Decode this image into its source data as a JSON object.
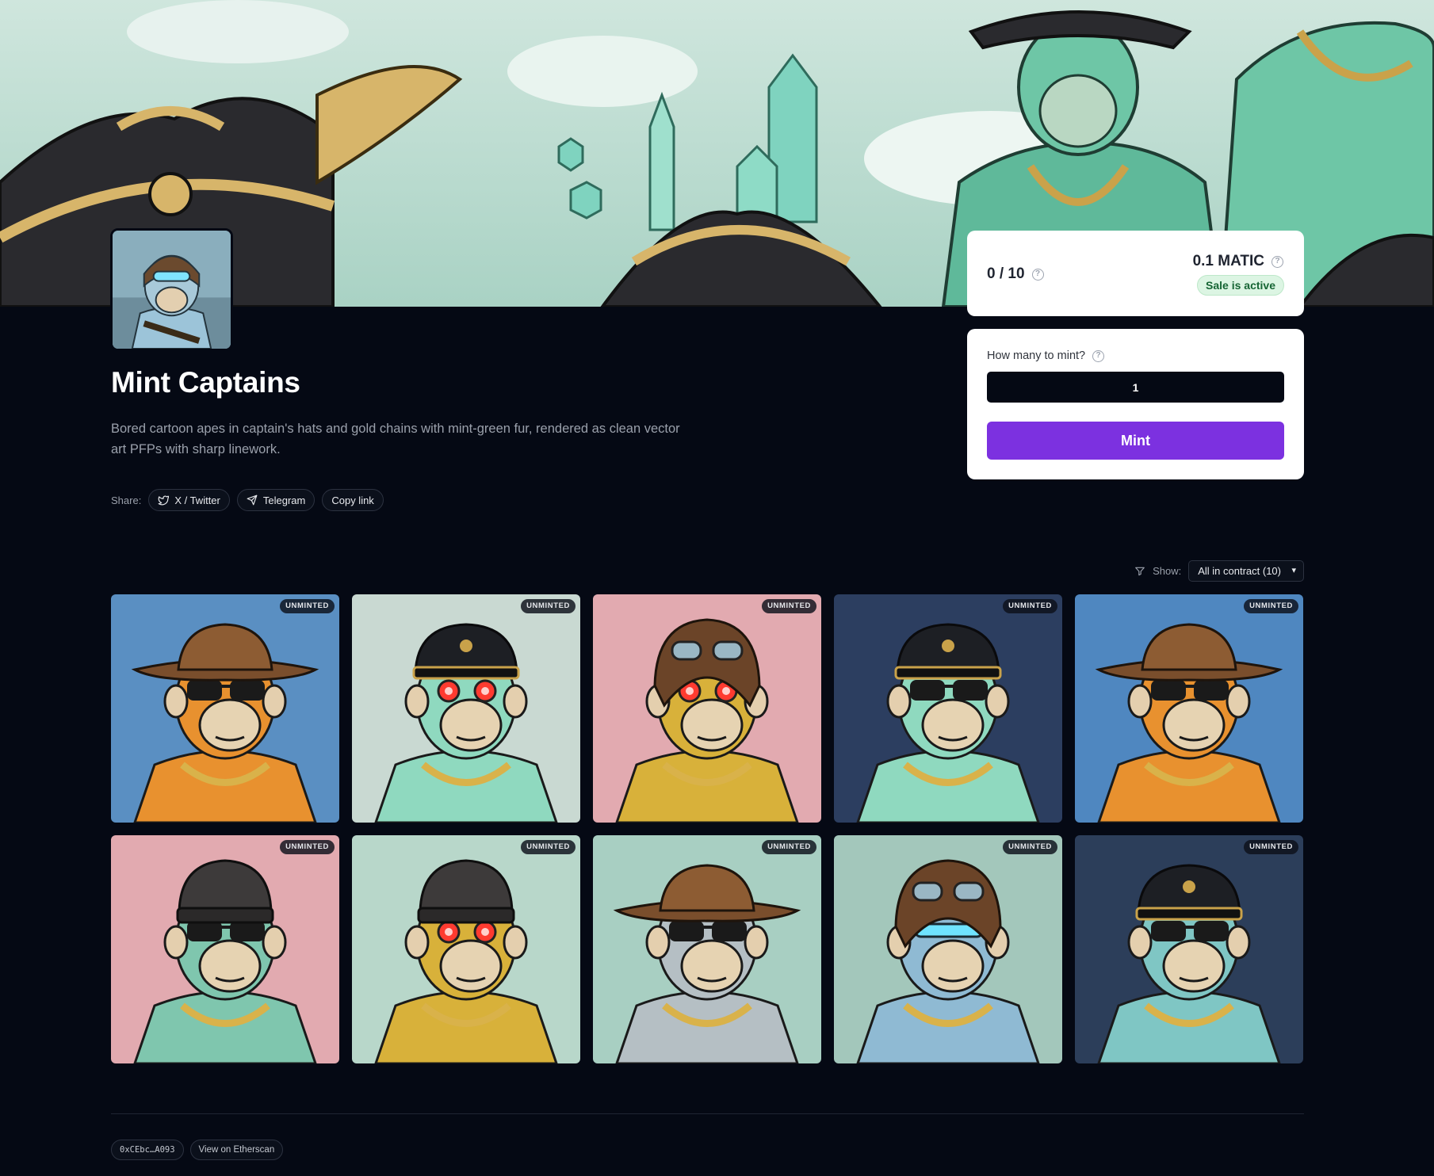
{
  "collection": {
    "title": "Mint Captains",
    "description": "Bored cartoon apes in captain's hats and gold chains with mint-green fur, rendered as clean vector art PFPs with sharp linework."
  },
  "share": {
    "label": "Share:",
    "twitter": "X / Twitter",
    "telegram": "Telegram",
    "copy": "Copy link"
  },
  "stats": {
    "supply": "0 / 10",
    "price": "0.1 MATIC",
    "sale_status": "Sale is active"
  },
  "mint": {
    "question": "How many to mint?",
    "quantity": "1",
    "button": "Mint"
  },
  "filter": {
    "label": "Show:",
    "selected": "All in contract (10)"
  },
  "tiles": [
    {
      "badge": "UNMINTED",
      "bg": "#5a8fc2",
      "fur": "#e8912f",
      "hat": "cowboy",
      "eyes": "shades"
    },
    {
      "badge": "UNMINTED",
      "bg": "#c9d9d2",
      "fur": "#8fd9bf",
      "hat": "captain",
      "eyes": "laser"
    },
    {
      "badge": "UNMINTED",
      "bg": "#e2aab0",
      "fur": "#d8b13a",
      "hat": "aviator",
      "eyes": "laser"
    },
    {
      "badge": "UNMINTED",
      "bg": "#2c3e60",
      "fur": "#8fd9bf",
      "hat": "captain",
      "eyes": "shades"
    },
    {
      "badge": "UNMINTED",
      "bg": "#4f87c0",
      "fur": "#e8912f",
      "hat": "cowboy",
      "eyes": "shades"
    },
    {
      "badge": "UNMINTED",
      "bg": "#e2aab0",
      "fur": "#7fc6ae",
      "hat": "beanie",
      "eyes": "shades"
    },
    {
      "badge": "UNMINTED",
      "bg": "#b8d7ca",
      "fur": "#d8b13a",
      "hat": "beanie",
      "eyes": "laser"
    },
    {
      "badge": "UNMINTED",
      "bg": "#a8cfc2",
      "fur": "#b5bfc4",
      "hat": "cowboy",
      "eyes": "shades"
    },
    {
      "badge": "UNMINTED",
      "bg": "#a3c7bb",
      "fur": "#8fbad3",
      "hat": "aviator",
      "eyes": "visor"
    },
    {
      "badge": "UNMINTED",
      "bg": "#2c3e5a",
      "fur": "#7fc6c4",
      "hat": "captain",
      "eyes": "shades"
    }
  ],
  "footer": {
    "contract": "0xCEbc…A093",
    "etherscan": "View on Etherscan"
  },
  "colors": {
    "page_bg": "#050914",
    "accent": "#7c31e0",
    "sale_badge_bg": "#dcf5e3",
    "sale_badge_text": "#166534"
  }
}
